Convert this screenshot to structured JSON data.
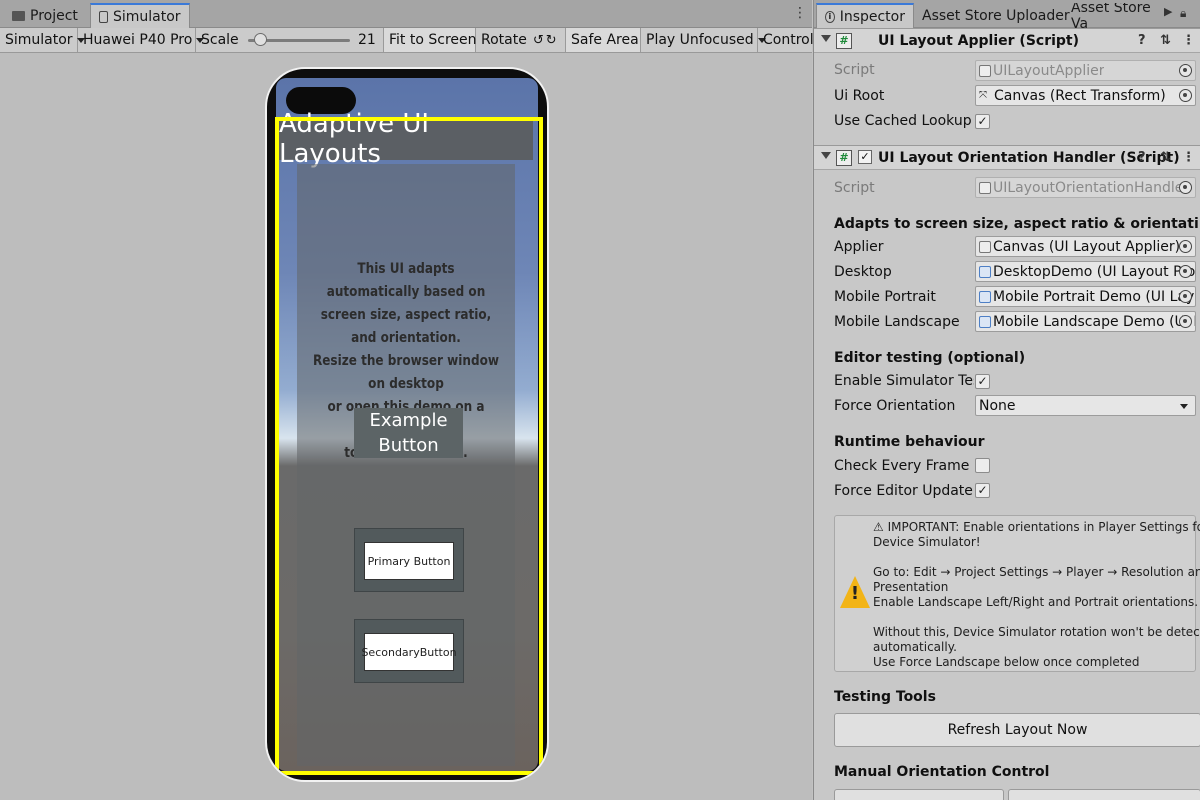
{
  "left_tabs": {
    "project": "Project",
    "simulator": "Simulator"
  },
  "toolbar": {
    "mode": "Simulator",
    "device": "Huawei P40 Pro",
    "scale_label": "Scale",
    "scale_value": "21",
    "fit_to_screen": "Fit to Screen",
    "rotate": "Rotate",
    "safe_area": "Safe Area",
    "play_mode": "Play Unfocused",
    "control": "Control"
  },
  "app": {
    "title": "Adaptive UI Layouts",
    "body_lines": [
      "This UI adapts automatically based on",
      "screen size, aspect ratio, and orientation.",
      "Resize the browser window on desktop",
      "or open this demo on a mobile device",
      "to see it in action."
    ],
    "example_button": "Example Button",
    "primary_button": "Primary Button",
    "secondary_button": "SecondaryButton"
  },
  "right_tabs": {
    "inspector": "Inspector",
    "asset_store_uploader": "Asset Store Uploader",
    "asset_store_va": "Asset Store Va"
  },
  "applier": {
    "title": "UI Layout Applier (Script)",
    "script_label": "Script",
    "script_value": "UILayoutApplier",
    "ui_root_label": "Ui Root",
    "ui_root_value": "Canvas (Rect Transform)",
    "cached_lookup_label": "Use Cached Lookup",
    "cached_lookup_checked": true
  },
  "handler": {
    "title": "UI Layout Orientation Handler (Script)",
    "enabled": true,
    "script_label": "Script",
    "script_value": "UILayoutOrientationHandler",
    "adapts_header": "Adapts to screen size, aspect ratio & orientation — Deskto",
    "applier_label": "Applier",
    "applier_value": "Canvas (UI Layout Applier)",
    "desktop_label": "Desktop",
    "desktop_value": "DesktopDemo (UI Layout Profil",
    "mobile_portrait_label": "Mobile Portrait",
    "mobile_portrait_value": "Mobile Portrait Demo (UI Layou",
    "mobile_landscape_label": "Mobile Landscape",
    "mobile_landscape_value": "Mobile Landscape Demo (UI La",
    "editor_testing_header": "Editor testing (optional)",
    "enable_sim_label": "Enable Simulator Testir",
    "enable_sim_checked": true,
    "force_orientation_label": "Force Orientation",
    "force_orientation_value": "None",
    "runtime_header": "Runtime behaviour",
    "check_every_frame_label": "Check Every Frame",
    "check_every_frame_checked": false,
    "force_editor_update_label": "Force Editor Update",
    "force_editor_update_checked": true,
    "help_lines": [
      "⚠ IMPORTANT: Enable orientations in Player Settings for",
      "Device Simulator!",
      "",
      "Go to: Edit → Project Settings → Player → Resolution and",
      "Presentation",
      "Enable Landscape Left/Right and Portrait orientations.",
      "",
      "Without this, Device Simulator rotation won't be detected",
      "automatically.",
      "Use Force Landscape below once completed"
    ],
    "testing_tools_header": "Testing Tools",
    "refresh_button": "Refresh Layout Now",
    "manual_orientation_header": "Manual Orientation Control"
  }
}
